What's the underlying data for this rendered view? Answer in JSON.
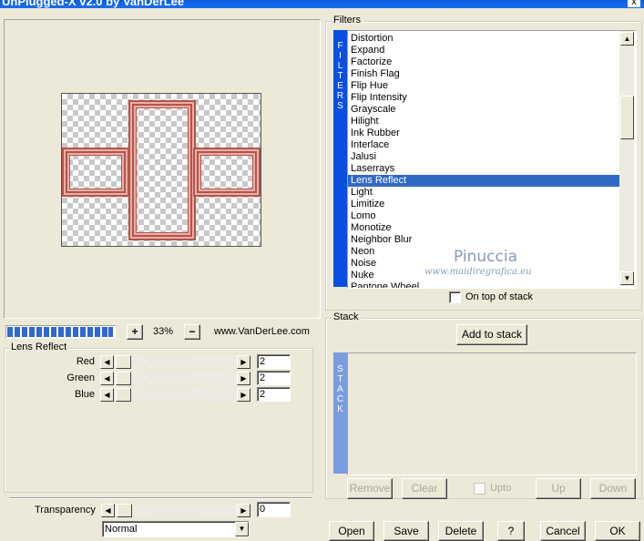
{
  "window": {
    "title": "UnPlugged-X v2.0 by VanDerLee",
    "close_glyph": "x"
  },
  "preview": {
    "zoom": "33%",
    "zoom_in": "+",
    "zoom_out": "−",
    "website": "www.VanDerLee.com",
    "progress": 1.0
  },
  "filters": {
    "group_label": "Filters",
    "side_label": "FILTERS",
    "items": [
      "Distortion",
      "Expand",
      "Factorize",
      "Finish Flag",
      "Flip Hue",
      "Flip Intensity",
      "Grayscale",
      "Hilight",
      "Ink Rubber",
      "Interlace",
      "Jalusi",
      "Laserrays",
      "Lens Reflect",
      "Light",
      "Limitize",
      "Lomo",
      "Monotize",
      "Neighbor Blur",
      "Neon",
      "Noise",
      "Nuke",
      "Pantone Wheel"
    ],
    "selected": "Lens Reflect",
    "on_top_label": "On top of stack"
  },
  "watermark": {
    "name": "Pinuccia",
    "url": "www.maidiregrafica.eu"
  },
  "params": {
    "group_label": "Lens Reflect",
    "rows": [
      {
        "label": "Red",
        "value": "2"
      },
      {
        "label": "Green",
        "value": "2"
      },
      {
        "label": "Blue",
        "value": "2"
      }
    ],
    "transparency_label": "Transparency",
    "transparency_value": "0",
    "blend_mode": "Normal"
  },
  "stack": {
    "group_label": "Stack",
    "add_button": "Add to stack",
    "side_label": "STACK",
    "remove": "Remove",
    "clear": "Clear",
    "upto": "Upto",
    "up": "Up",
    "down": "Down"
  },
  "actions": {
    "open": "Open",
    "save": "Save",
    "delete": "Delete",
    "help": "?",
    "cancel": "Cancel",
    "ok": "OK"
  },
  "colors": {
    "selection": "#316ac5",
    "frame": "#b5544a",
    "side_bar_filters": "#0a4fe0",
    "side_bar_stack": "#7a9ce0"
  }
}
